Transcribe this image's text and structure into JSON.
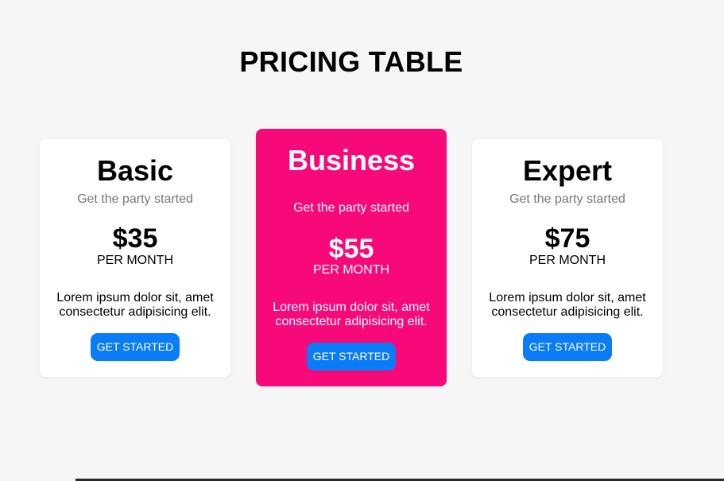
{
  "page": {
    "title": "PRICING TABLE"
  },
  "plans": [
    {
      "name": "Basic",
      "tagline": "Get the party started",
      "price": "$35",
      "period": "PER MONTH",
      "description": "Lorem ipsum dolor sit, amet consectetur adipisicing elit.",
      "cta": "GET STARTED"
    },
    {
      "name": "Business",
      "tagline": "Get the party started",
      "price": "$55",
      "period": "PER MONTH",
      "description": "Lorem ipsum dolor sit, amet consectetur adipisicing elit.",
      "cta": "GET STARTED"
    },
    {
      "name": "Expert",
      "tagline": "Get the party started",
      "price": "$75",
      "period": "PER MONTH",
      "description": "Lorem ipsum dolor sit, amet consectetur adipisicing elit.",
      "cta": "GET STARTED"
    }
  ],
  "colors": {
    "page_background": "#f6f6f6",
    "card_background": "#ffffff",
    "featured_background": "#f7097a",
    "button_background": "#0b7cf7",
    "tagline_text": "#777777"
  }
}
